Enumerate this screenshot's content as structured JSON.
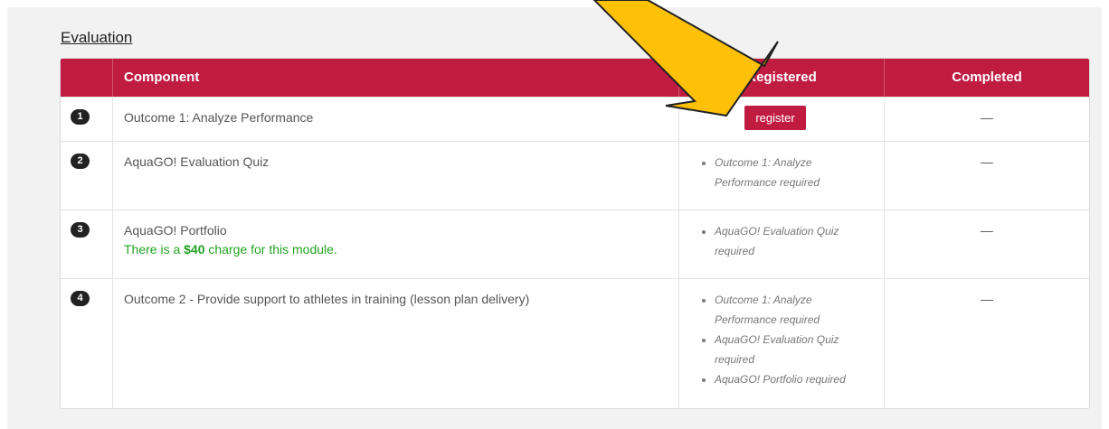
{
  "section": {
    "title": "Evaluation"
  },
  "table": {
    "headers": {
      "num": "",
      "component": "Component",
      "registered": "Registered",
      "completed": "Completed"
    },
    "rows": [
      {
        "num": "1",
        "component": "Outcome 1: Analyze Performance",
        "register_label": "register",
        "completed": "—"
      },
      {
        "num": "2",
        "component": "AquaGO! Evaluation Quiz",
        "requirements": [
          "Outcome 1: Analyze Performance required"
        ],
        "completed": "—"
      },
      {
        "num": "3",
        "component": "AquaGO! Portfolio",
        "charge": {
          "prefix": "There is a ",
          "amount": "$40",
          "suffix": " charge for this module."
        },
        "requirements": [
          "AquaGO! Evaluation Quiz required"
        ],
        "completed": "—"
      },
      {
        "num": "4",
        "component": "Outcome 2 - Provide support to athletes in training (lesson plan delivery)",
        "requirements": [
          "Outcome 1: Analyze Performance required",
          "AquaGO! Evaluation Quiz required",
          "AquaGO! Portfolio required"
        ],
        "completed": "—"
      }
    ]
  },
  "colors": {
    "accent": "#c01c41",
    "charge_text": "#22a322",
    "arrow_fill": "#ffc107"
  },
  "annotation": {
    "icon": "arrow-pointer-icon"
  }
}
